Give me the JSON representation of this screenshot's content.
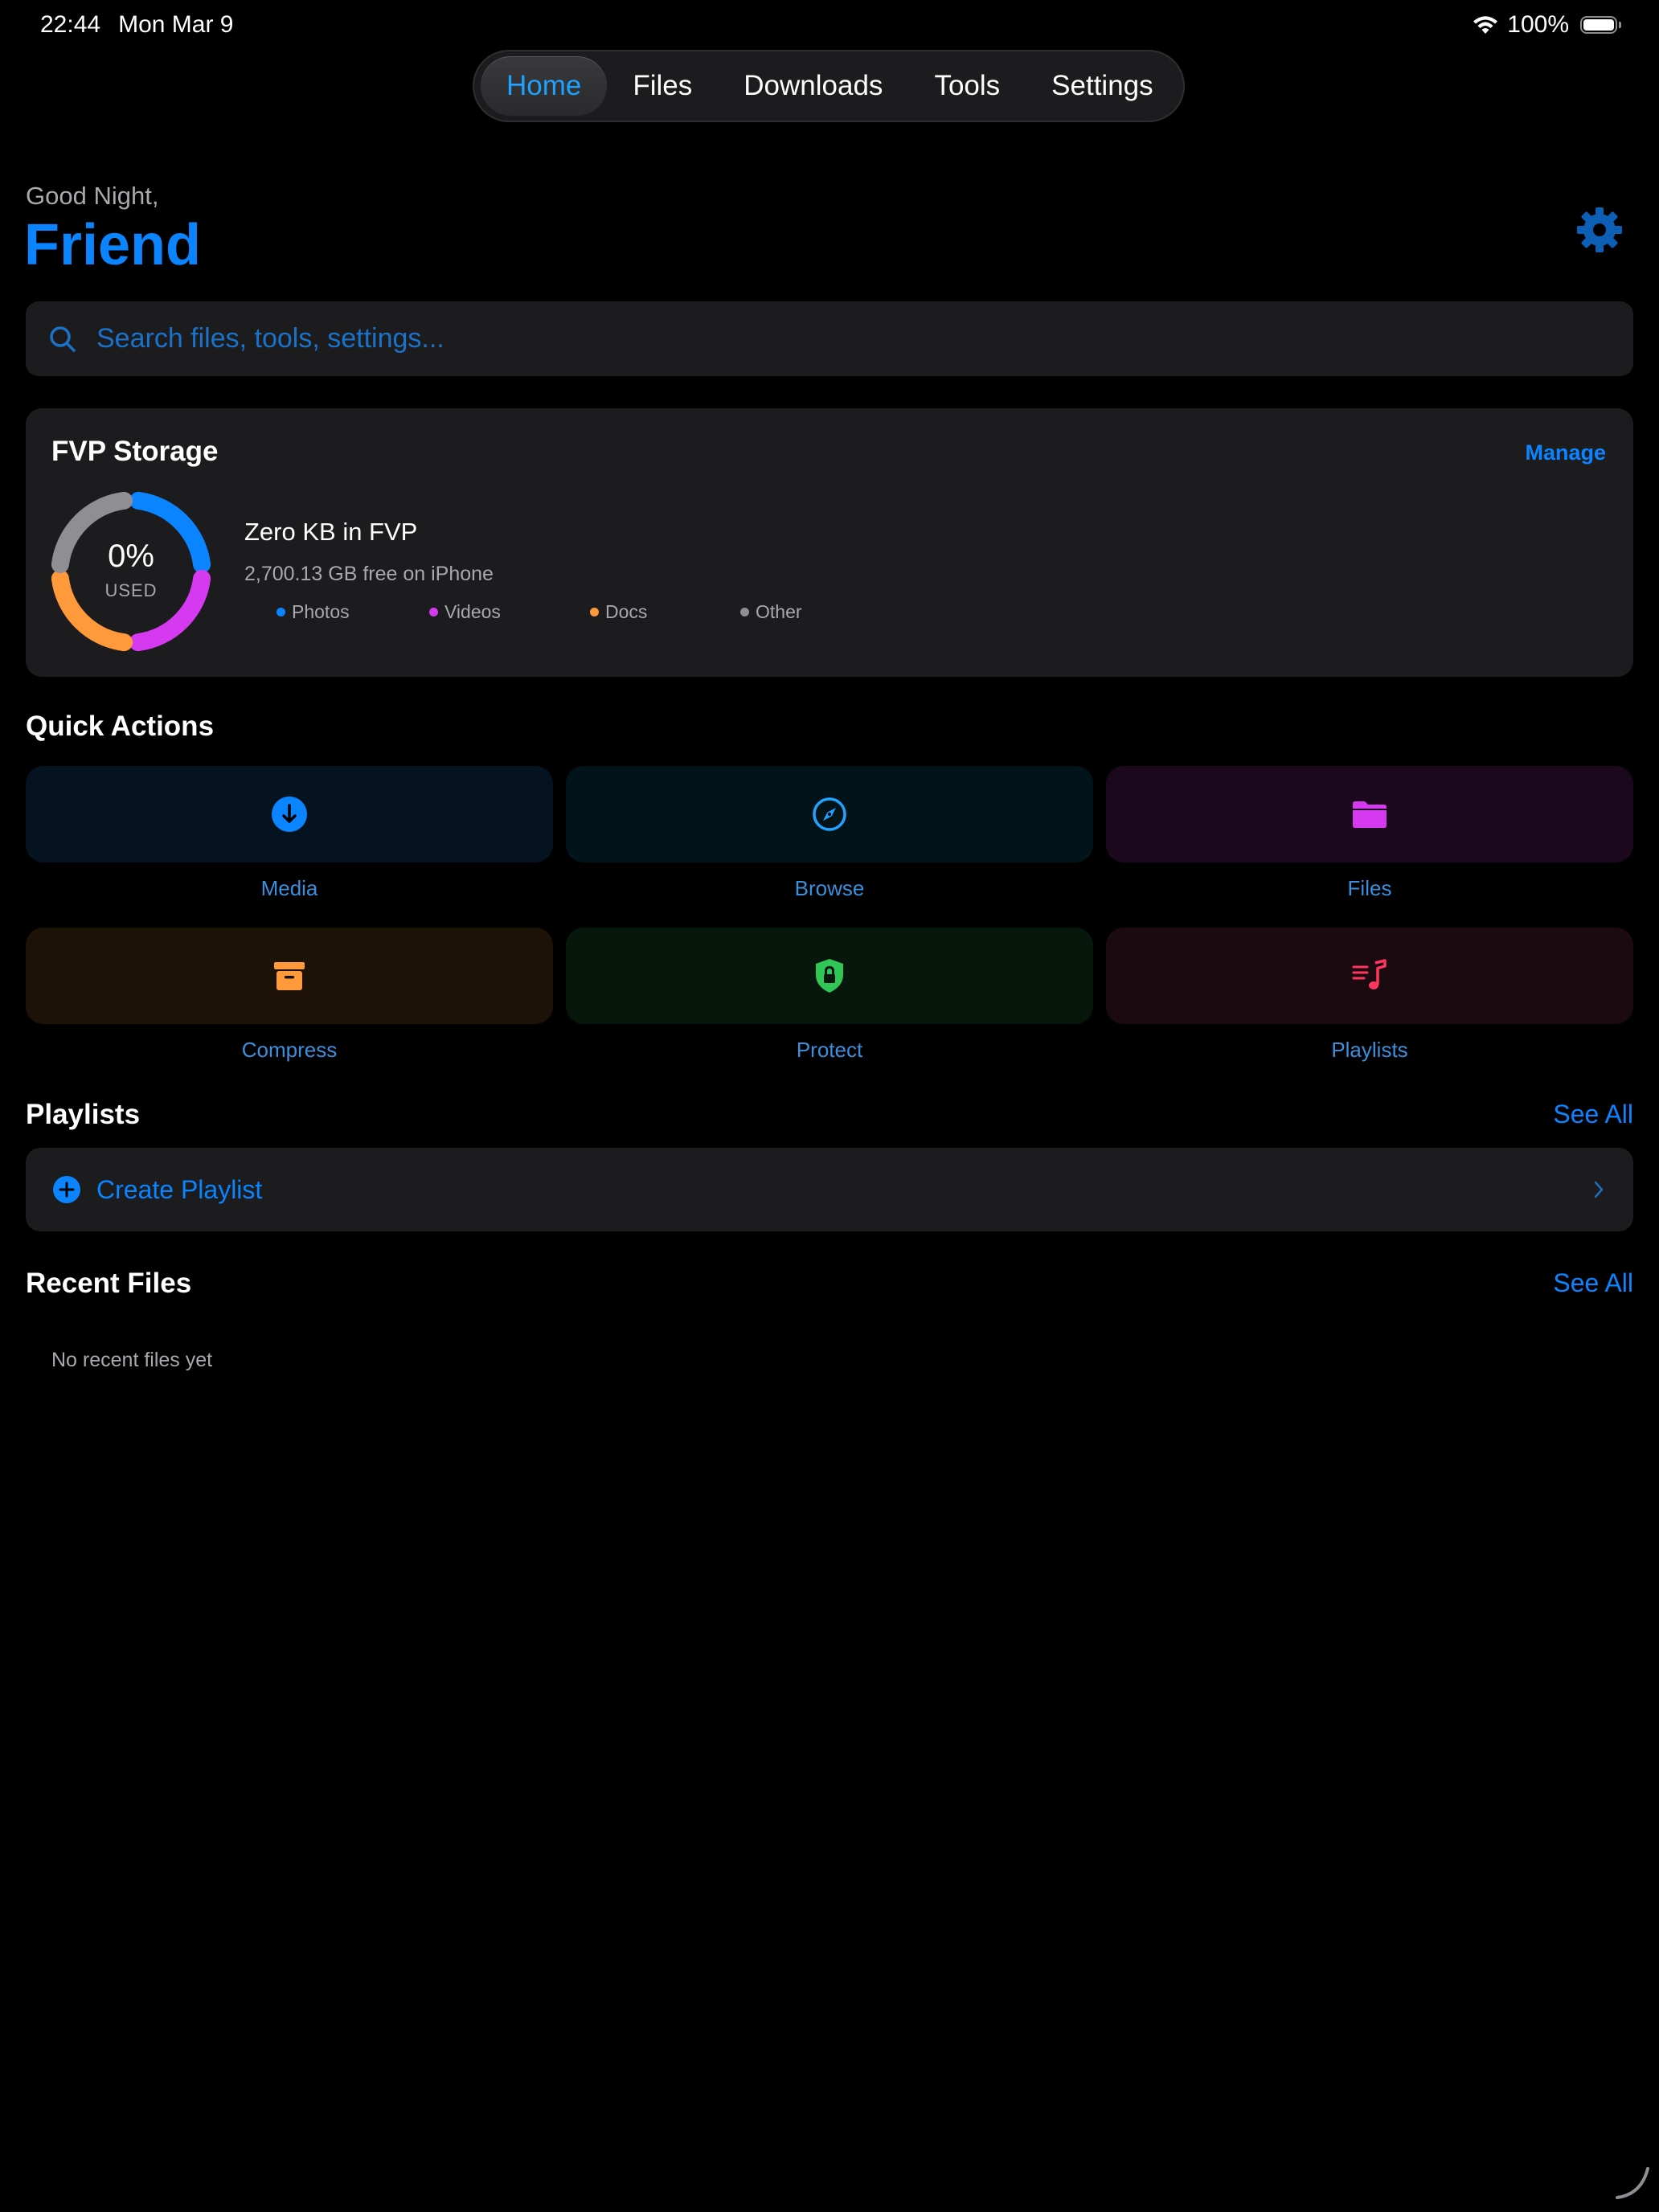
{
  "status_bar": {
    "time": "22:44",
    "date": "Mon Mar 9",
    "battery": "100%"
  },
  "nav": {
    "tabs": [
      {
        "label": "Home",
        "active": true
      },
      {
        "label": "Files",
        "active": false
      },
      {
        "label": "Downloads",
        "active": false
      },
      {
        "label": "Tools",
        "active": false
      },
      {
        "label": "Settings",
        "active": false
      }
    ]
  },
  "header": {
    "greeting": "Good Night,",
    "name": "Friend",
    "settings_icon": "gear-icon"
  },
  "search": {
    "placeholder": "Search files, tools, settings..."
  },
  "storage": {
    "title": "FVP Storage",
    "manage": "Manage",
    "percent": "0%",
    "used_label": "USED",
    "headline": "Zero KB in FVP",
    "free": "2,700.13 GB free on iPhone",
    "legend": [
      {
        "label": "Photos",
        "color": "#0a84ff"
      },
      {
        "label": "Videos",
        "color": "#d63af0"
      },
      {
        "label": "Docs",
        "color": "#ff9a3c"
      },
      {
        "label": "Other",
        "color": "#8e8e93"
      }
    ]
  },
  "quick_actions": {
    "title": "Quick Actions",
    "items": [
      {
        "label": "Media",
        "icon": "download-circle-icon",
        "color": "#0a84ff"
      },
      {
        "label": "Browse",
        "icon": "compass-icon",
        "color": "#20a4ff"
      },
      {
        "label": "Files",
        "icon": "folder-icon",
        "color": "#d63af0"
      },
      {
        "label": "Compress",
        "icon": "archive-box-icon",
        "color": "#ff9a3c"
      },
      {
        "label": "Protect",
        "icon": "lock-shield-icon",
        "color": "#30c758"
      },
      {
        "label": "Playlists",
        "icon": "music-list-icon",
        "color": "#ff375f"
      }
    ]
  },
  "playlists": {
    "title": "Playlists",
    "see_all": "See All",
    "create": "Create Playlist"
  },
  "recent_files": {
    "title": "Recent Files",
    "see_all": "See All",
    "empty": "No recent files yet"
  }
}
